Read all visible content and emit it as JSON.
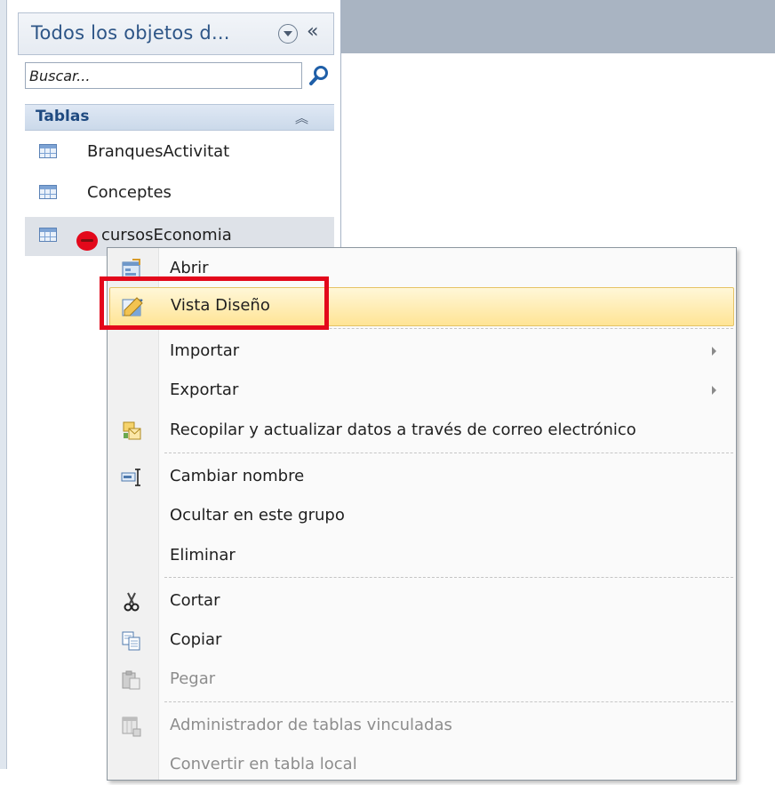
{
  "nav_pane": {
    "title": "Todos los objetos d...",
    "collapse_glyph": "«",
    "search": {
      "placeholder": "Buscar..."
    },
    "group": {
      "title": "Tablas",
      "toggle_glyph": "⌃"
    },
    "items": [
      {
        "label": "BranquesActivitat",
        "icon": "table-icon"
      },
      {
        "label": "Conceptes",
        "icon": "table-icon"
      },
      {
        "label": "cursosEconomia",
        "icon": "table-icon",
        "selected": true
      }
    ]
  },
  "context_menu": {
    "items": [
      {
        "label": "Abrir",
        "icon": "open-form-icon"
      },
      {
        "label": "Vista Diseño",
        "icon": "design-view-icon",
        "highlighted": true
      },
      {
        "label": "Importar",
        "submenu": true
      },
      {
        "label": "Exportar",
        "submenu": true
      },
      {
        "label": "Recopilar y actualizar datos a través de correo electrónico",
        "icon": "collect-data-icon"
      },
      {
        "label": "Cambiar nombre",
        "icon": "rename-icon"
      },
      {
        "label": "Ocultar en este grupo"
      },
      {
        "label": "Eliminar"
      },
      {
        "label": "Cortar",
        "icon": "scissors-icon"
      },
      {
        "label": "Copiar",
        "icon": "copy-icon"
      },
      {
        "label": "Pegar",
        "icon": "paste-icon",
        "disabled": true
      },
      {
        "label": "Administrador de tablas vinculadas",
        "icon": "linked-table-manager-icon",
        "disabled": true
      },
      {
        "label": "Convertir en tabla local",
        "disabled": true
      }
    ]
  },
  "colors": {
    "nav_title": "#2d5587",
    "highlight": "#ffe495",
    "annotation_red": "#e3081b"
  }
}
